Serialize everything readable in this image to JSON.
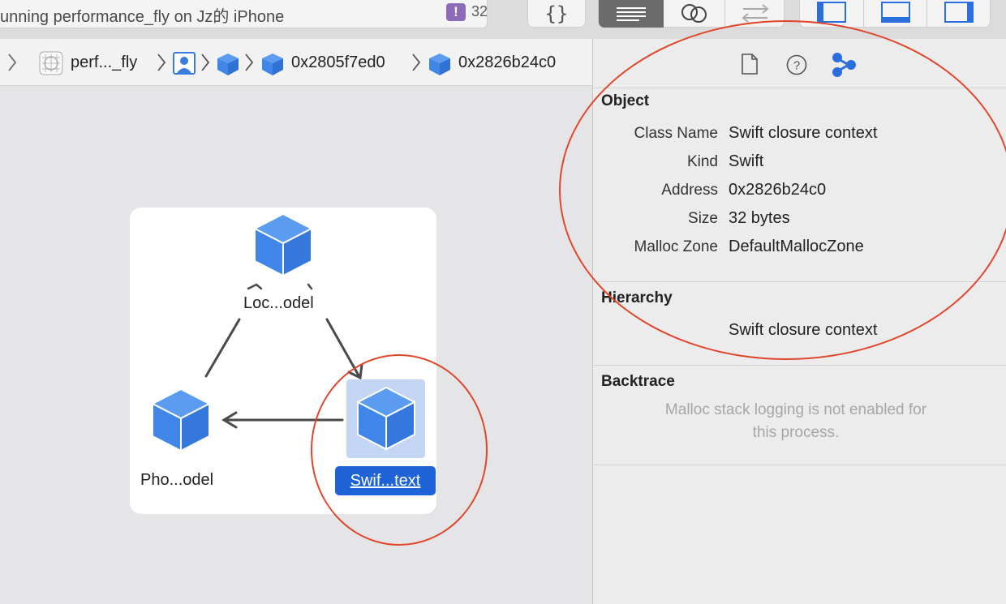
{
  "toolbar": {
    "activity_text": "unning performance_fly on Jz的 iPhone",
    "warning_badge": "!",
    "warning_count": "32",
    "braces_label": "{}"
  },
  "jumpbar": {
    "items": [
      {
        "label": "perf..._fly",
        "icon": "app-grid-icon"
      },
      {
        "label": "",
        "icon": "person-icon"
      },
      {
        "label": "",
        "icon": "cube-icon"
      },
      {
        "label": "0x2805f7ed0",
        "icon": "cube-icon"
      },
      {
        "label": "0x2826b24c0",
        "icon": "cube-icon"
      }
    ]
  },
  "graph": {
    "nodes": [
      {
        "id": "loc",
        "label": "Loc...odel",
        "selected": false
      },
      {
        "id": "pho",
        "label": "Pho...odel",
        "selected": false
      },
      {
        "id": "swift",
        "label": "Swif...text",
        "selected": true
      }
    ]
  },
  "inspector": {
    "tabs": [
      "file-icon",
      "help-icon",
      "memory-graph-icon"
    ],
    "object": {
      "title": "Object",
      "rows": [
        {
          "key": "Class Name",
          "value": "Swift closure context"
        },
        {
          "key": "Kind",
          "value": "Swift"
        },
        {
          "key": "Address",
          "value": "0x2826b24c0"
        },
        {
          "key": "Size",
          "value": "32 bytes"
        },
        {
          "key": "Malloc Zone",
          "value": "DefaultMallocZone"
        }
      ]
    },
    "hierarchy": {
      "title": "Hierarchy",
      "value": "Swift closure context"
    },
    "backtrace": {
      "title": "Backtrace",
      "message_line1": "Malloc stack logging is not enabled for",
      "message_line2": "this process."
    }
  },
  "colors": {
    "accent": "#1f63d9",
    "cube": "#3f86e8",
    "annotation": "#e0462a"
  }
}
